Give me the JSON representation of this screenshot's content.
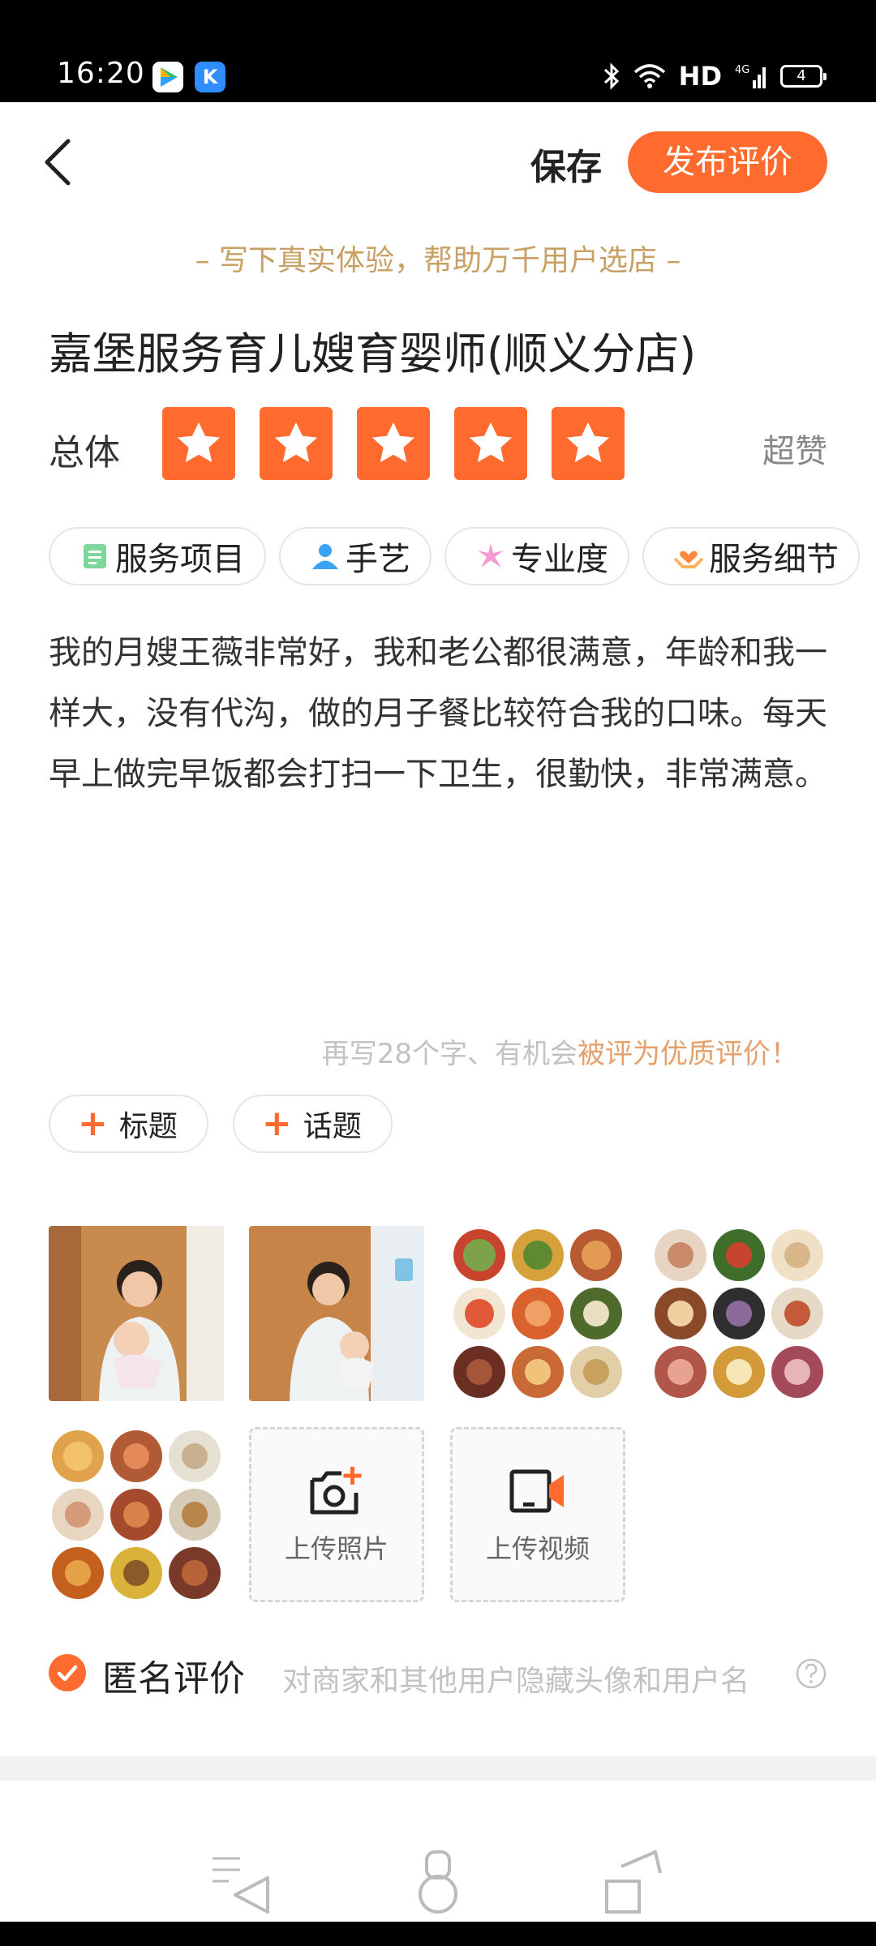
{
  "status_bar": {
    "time": "16:20",
    "network": "HD",
    "signal": "4G",
    "battery": "4",
    "icons": [
      "video-app-icon",
      "k-app-icon",
      "bluetooth-icon",
      "wifi-icon",
      "signal-icon",
      "battery-icon"
    ]
  },
  "header": {
    "back_icon": "chevron-left-icon",
    "save_label": "保存",
    "publish_label": "发布评价",
    "accent_color": "#ff6a2e"
  },
  "tip": "– 写下真实体验，帮助万千用户选店 –",
  "shop_name": "嘉堡服务育儿嫂育婴师(顺义分店)",
  "rating": {
    "label": "总体",
    "stars": 5,
    "max_stars": 5,
    "word": "超赞"
  },
  "tags": [
    {
      "label": "服务项目",
      "icon": "list-icon"
    },
    {
      "label": "手艺",
      "icon": "person-icon"
    },
    {
      "label": "专业度",
      "icon": "sparkle-icon"
    },
    {
      "label": "服务细节",
      "icon": "hands-heart-icon"
    }
  ],
  "review_text": "我的月嫂王薇非常好，我和老公都很满意，年龄和我一样大，没有代沟，做的月子餐比较符合我的口味。每天早上做完早饭都会打扫一下卫生，很勤快，非常满意。",
  "word_hint": {
    "prefix": "再写28个字、有机会",
    "highlight": "被评为优质评价！"
  },
  "chips": [
    {
      "label": "标题"
    },
    {
      "label": "话题"
    }
  ],
  "uploads": {
    "photo_label": "上传照片",
    "video_label": "上传视频"
  },
  "anonymous": {
    "checked": true,
    "label": "匿名评价",
    "description": "对商家和其他用户隐藏头像和用户名"
  }
}
